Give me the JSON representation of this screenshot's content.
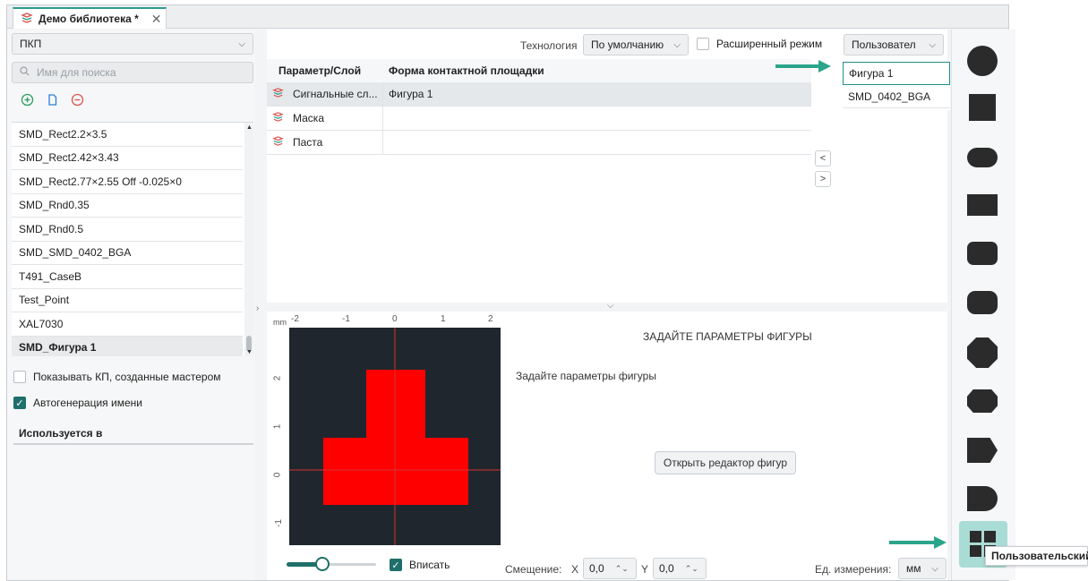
{
  "tab": {
    "title": "Демо библиотека *",
    "close": "✕"
  },
  "left": {
    "category": "ПКП",
    "search_placeholder": "Имя для поиска",
    "items": [
      "SMD_Rect2.2×3.5",
      "SMD_Rect2.42×3.43",
      "SMD_Rect2.77×2.55 Off -0.025×0",
      "SMD_Rnd0.35",
      "SMD_Rnd0.5",
      "SMD_SMD_0402_BGA",
      "T491_CaseB",
      "Test_Point",
      "XAL7030",
      "SMD_Фигура 1"
    ],
    "show_wizard": "Показывать КП, созданные мастером",
    "autoname": "Автогенерация имени",
    "used_in": "Используется в"
  },
  "center": {
    "tech_label": "Технология",
    "tech_value": "По умолчанию",
    "advanced": "Расширенный режим",
    "user_combo": "Пользовател",
    "col_param": "Параметр/Слой",
    "col_shape": "Форма контактной площадки",
    "rows": [
      {
        "layer": "Сигнальные сл...",
        "shape": "Фигура 1"
      },
      {
        "layer": "Маска",
        "shape": ""
      },
      {
        "layer": "Паста",
        "shape": ""
      }
    ],
    "user_items": [
      "Фигура 1",
      "SMD_0402_BGA"
    ],
    "nav_prev": "<",
    "nav_next": ">"
  },
  "preview": {
    "unit": "mm",
    "x_ticks": [
      "-2",
      "-1",
      "0",
      "1",
      "2"
    ],
    "y_ticks": [
      "2",
      "1",
      "0",
      "-1"
    ],
    "heading": "ЗАДАЙТЕ ПАРАМЕТРЫ ФИГУРЫ",
    "hint": "Задайте параметры фигуры",
    "open_editor": "Открыть редактор фигур",
    "fit": "Вписать",
    "offset_label": "Смещение:",
    "x_label": "X",
    "x_value": "0,0",
    "y_label": "Y",
    "y_value": "0,0",
    "units_label": "Ед. измерения:",
    "units_value": "мм",
    "zoom_level": 0.4
  },
  "palette": {
    "tooltip": "Пользовательский"
  },
  "colors": {
    "accent": "#1f6f6a",
    "shape_fill": "#ff0000",
    "canvas_bg": "#20262d"
  }
}
